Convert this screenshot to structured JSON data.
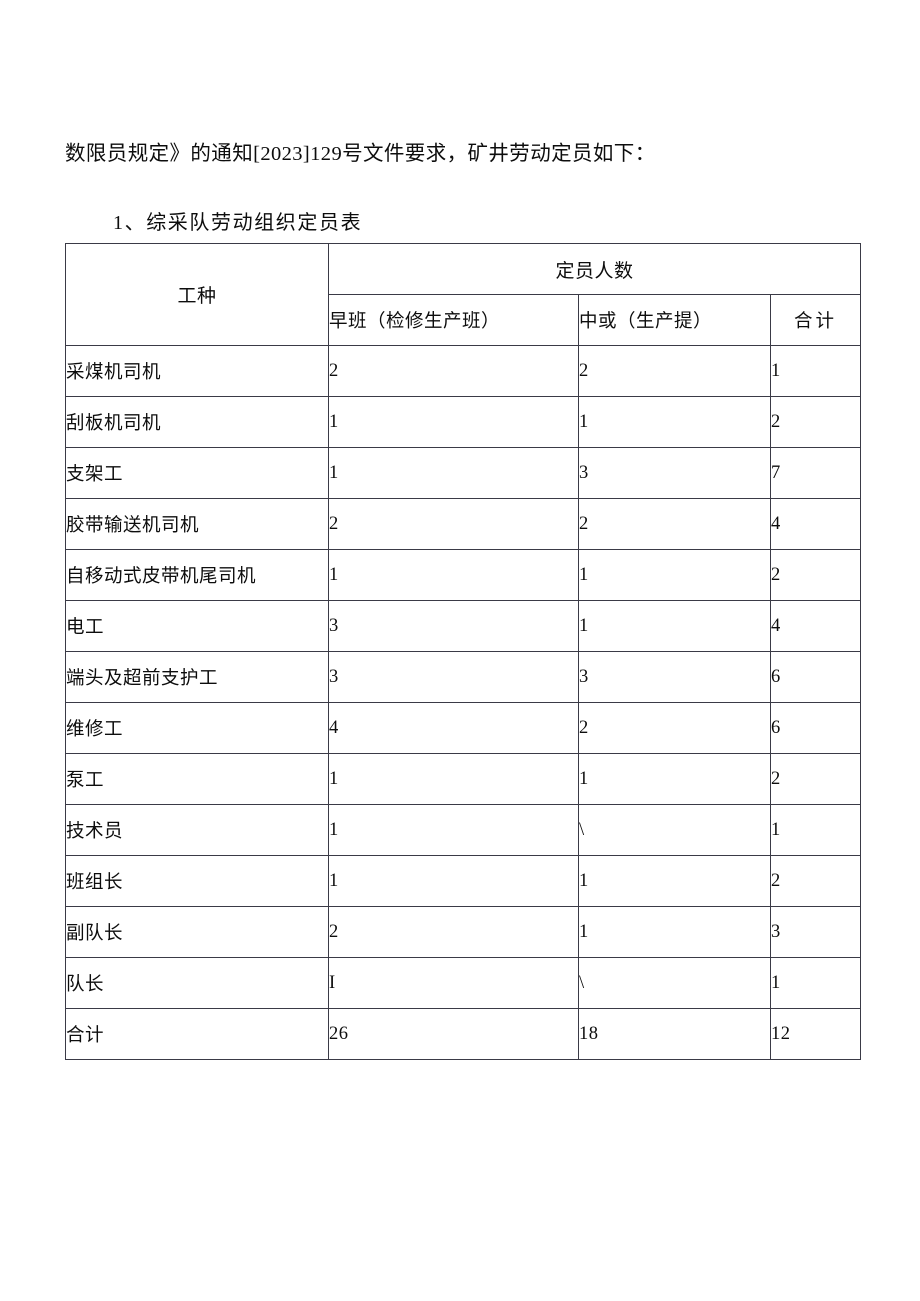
{
  "document": {
    "intro_text": "数限员规定》的通知[2023]129号文件要求，矿井劳动定员如下：",
    "section_heading": "1、综采队劳动组织定员表"
  },
  "table": {
    "header": {
      "job_column": "工种",
      "group_label": "定员人数",
      "sub_columns": [
        "早班（检修生产班）",
        "中或（生产提）",
        "合计"
      ]
    },
    "rows": [
      {
        "job": "采煤机司机",
        "early": "2",
        "mid": "2",
        "total": "1"
      },
      {
        "job": "刮板机司机",
        "early": "1",
        "mid": "1",
        "total": "2"
      },
      {
        "job": "支架工",
        "early": "1",
        "mid": "3",
        "total": "7"
      },
      {
        "job": "胶带输送机司机",
        "early": "2",
        "mid": "2",
        "total": "4"
      },
      {
        "job": "自移动式皮带机尾司机",
        "early": "1",
        "mid": "1",
        "total": "2"
      },
      {
        "job": "电工",
        "early": "3",
        "mid": "1",
        "total": "4"
      },
      {
        "job": "端头及超前支护工",
        "early": "3",
        "mid": "3",
        "total": "6"
      },
      {
        "job": "维修工",
        "early": "4",
        "mid": "2",
        "total": "6"
      },
      {
        "job": "泵工",
        "early": "1",
        "mid": "1",
        "total": "2"
      },
      {
        "job": "技术员",
        "early": "1",
        "mid": "\\",
        "total": "1"
      },
      {
        "job": "班组长",
        "early": "1",
        "mid": "1",
        "total": "2"
      },
      {
        "job": "副队长",
        "early": "2",
        "mid": "1",
        "total": "3"
      },
      {
        "job": "队长",
        "early": "I",
        "mid": "\\",
        "total": "1"
      },
      {
        "job": "合计",
        "early": "26",
        "mid": "18",
        "total": "12"
      }
    ]
  },
  "colors": {
    "text": "#0d0d0d",
    "border": "#3a3a46",
    "background": "#ffffff"
  }
}
